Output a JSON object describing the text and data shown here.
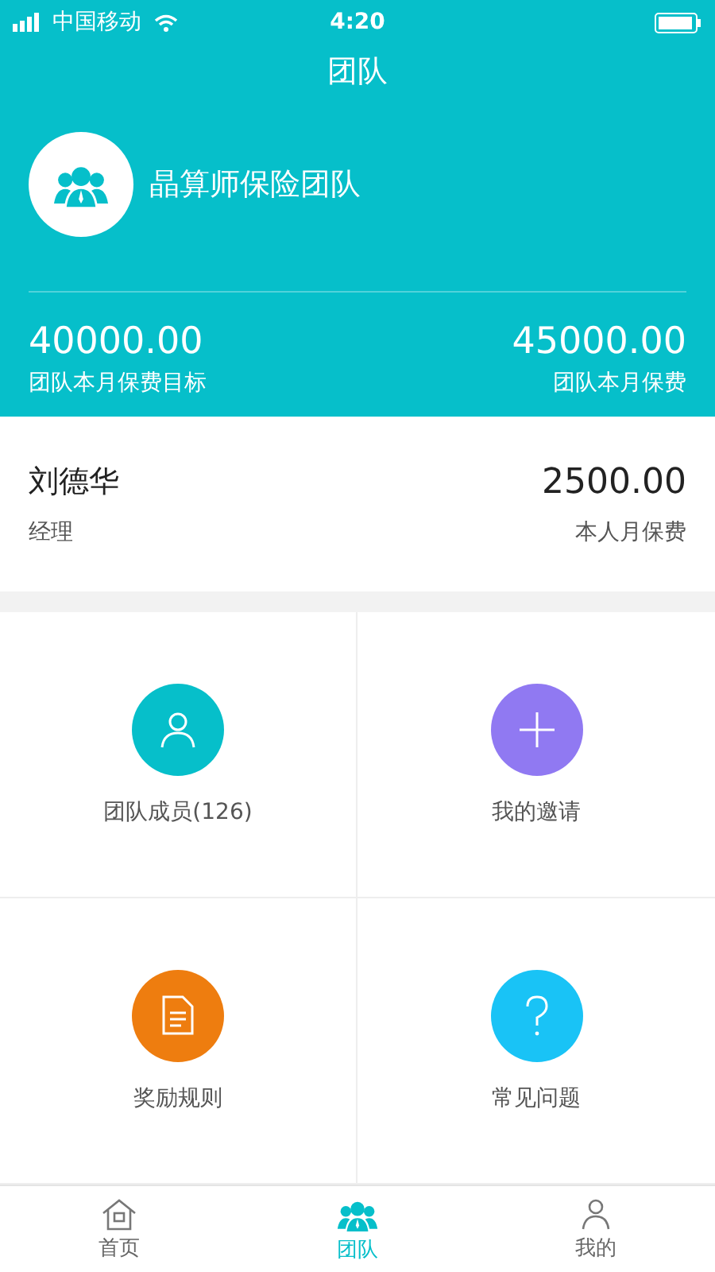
{
  "status_bar": {
    "carrier": "中国移动",
    "time": "4:20"
  },
  "nav": {
    "title": "团队"
  },
  "team": {
    "name": "晶算师保险团队"
  },
  "stats": [
    {
      "value": "40000.00",
      "label": "团队本月保费目标"
    },
    {
      "value": "45000.00",
      "label": "团队本月保费"
    }
  ],
  "member": {
    "name": "刘德华",
    "role": "经理",
    "value": "2500.00",
    "label": "本人月保费"
  },
  "grid": [
    {
      "kind": "person",
      "color": "#06bfca",
      "label": "团队成员(126)"
    },
    {
      "kind": "plus",
      "color": "#9079f2",
      "label": "我的邀请"
    },
    {
      "kind": "document",
      "color": "#ee7d0f",
      "label": "奖励规则"
    },
    {
      "kind": "question",
      "color": "#19c3f6",
      "label": "常见问题"
    }
  ],
  "tabs": [
    {
      "kind": "home",
      "label": "首页",
      "selected": false
    },
    {
      "kind": "team",
      "label": "团队",
      "selected": true
    },
    {
      "kind": "person",
      "label": "我的",
      "selected": false
    }
  ]
}
